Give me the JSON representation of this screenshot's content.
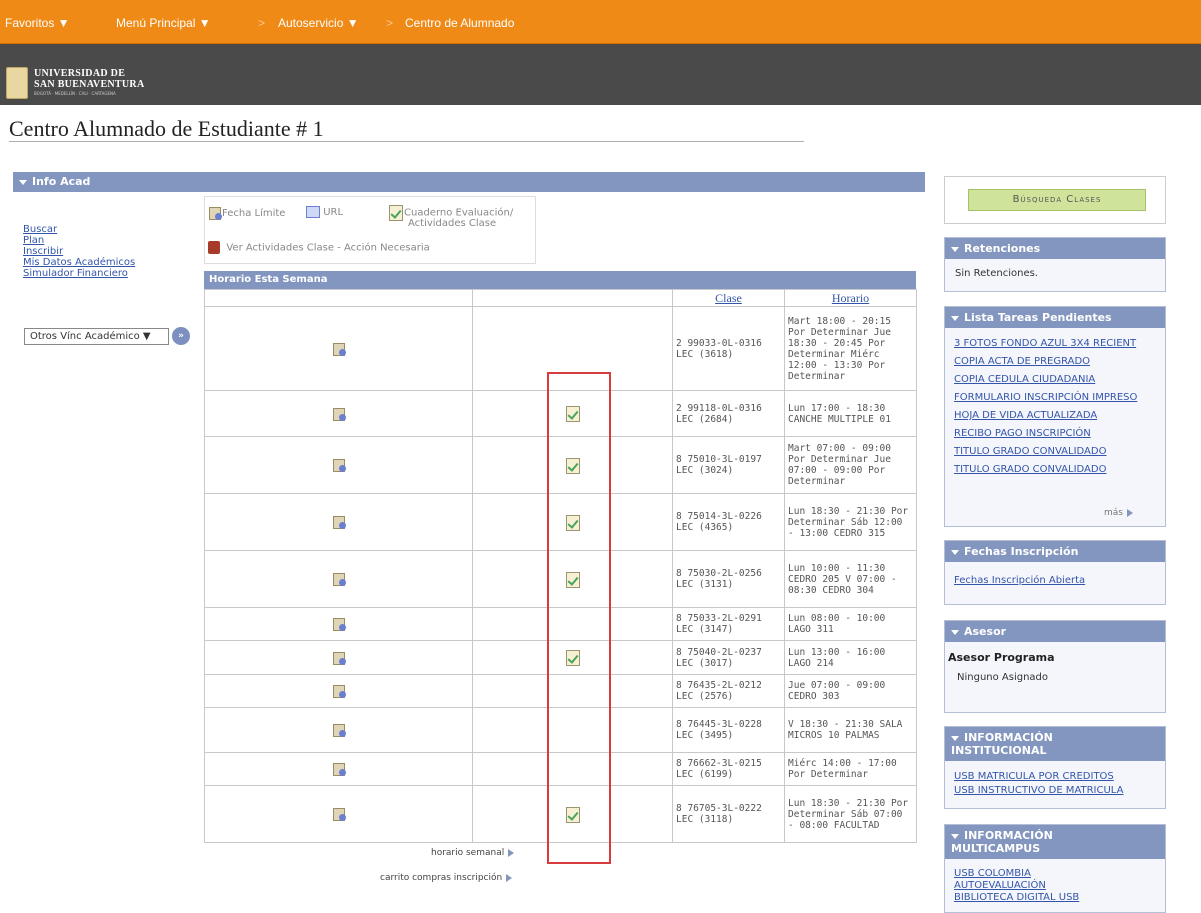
{
  "topnav": {
    "favoritos": "Favoritos ▼",
    "menu_principal": "Menú Principal ▼",
    "autoservicio": "Autoservicio ▼",
    "centro": "Centro de Alumnado",
    "separator": ">"
  },
  "logo": {
    "line1": "UNIVERSIDAD DE",
    "line2": "SAN BUENAVENTURA",
    "line3": "BOGOTÁ · MEDELLÍN · CALI · CARTAGENA"
  },
  "page_title": "Centro Alumnado de Estudiante # 1",
  "info_acad": {
    "title": "Info Acad",
    "links": [
      "Buscar",
      "Plan",
      "Inscribir",
      "Mis Datos Académicos",
      "Simulador Financiero"
    ],
    "otros_select": "Otros Vínc Académico ▼",
    "go_symbol": "»"
  },
  "legend": {
    "fecha_limite": "Fecha Límite",
    "url": "URL",
    "cuaderno_1": "Cuaderno Evaluación/",
    "cuaderno_2": "Actividades Clase",
    "ver_actividades": "Ver Actividades Clase - Acción Necesaria"
  },
  "schedule": {
    "title": "Horario Esta Semana",
    "col_clase": "Clase",
    "col_horario": "Horario",
    "rows": [
      {
        "clase": "2 99033-0L-0316 LEC (3618)",
        "horario": "Mart 18:00 - 20:15 Por Determinar Jue 18:30 - 20:45 Por Determinar Miérc 12:00 - 13:30 Por Determinar",
        "check": false
      },
      {
        "clase": "2 99118-0L-0316 LEC (2684)",
        "horario": "Lun 17:00 - 18:30 CANCHE MULTIPLE 01",
        "check": true
      },
      {
        "clase": "8 75010-3L-0197 LEC (3024)",
        "horario": "Mart 07:00 - 09:00 Por Determinar Jue 07:00 - 09:00 Por Determinar",
        "check": true
      },
      {
        "clase": "8 75014-3L-0226 LEC (4365)",
        "horario": "Lun 18:30 - 21:30 Por Determinar Sáb 12:00 - 13:00 CEDRO 315",
        "check": true
      },
      {
        "clase": "8 75030-2L-0256 LEC (3131)",
        "horario": "Lun 10:00 - 11:30 CEDRO 205 V 07:00 - 08:30 CEDRO 304",
        "check": true
      },
      {
        "clase": "8 75033-2L-0291 LEC (3147)",
        "horario": "Lun 08:00 - 10:00 LAGO 311",
        "check": false
      },
      {
        "clase": "8 75040-2L-0237 LEC (3017)",
        "horario": "Lun 13:00 - 16:00 LAGO 214",
        "check": true
      },
      {
        "clase": "8 76435-2L-0212 LEC (2576)",
        "horario": "Jue 07:00 - 09:00 CEDRO 303",
        "check": false
      },
      {
        "clase": "8 76445-3L-0228 LEC (3495)",
        "horario": "V 18:30 - 21:30 SALA MICROS 10 PALMAS",
        "check": false
      },
      {
        "clase": "8 76662-3L-0215 LEC (6199)",
        "horario": "Miérc 14:00 - 17:00 Por Determinar",
        "check": false
      },
      {
        "clase": "8 76705-3L-0222 LEC (3118)",
        "horario": "Lun 18:30 - 21:30 Por Determinar Sáb 07:00 - 08:00 FACULTAD",
        "check": true
      }
    ],
    "horario_semanal": "horario semanal",
    "carrito": "carrito compras inscripción"
  },
  "right": {
    "busqueda_btn": "Búsqueda Clases",
    "retenciones": {
      "title": "Retenciones",
      "body": "Sin Retenciones."
    },
    "tareas": {
      "title": "Lista Tareas Pendientes",
      "items": [
        "3 FOTOS FONDO AZUL 3X4 RECIENT",
        "COPIA ACTA DE PREGRADO",
        "COPIA CEDULA CIUDADANIA",
        "FORMULARIO INSCRIPCIÓN IMPRESO",
        "HOJA DE VIDA ACTUALIZADA",
        "RECIBO PAGO INSCRIPCIÓN",
        "TITULO GRADO CONVALIDADO",
        "TITULO GRADO CONVALIDADO"
      ],
      "mas": "más"
    },
    "fechas": {
      "title": "Fechas Inscripción",
      "link": "Fechas Inscripción Abierta"
    },
    "asesor": {
      "title": "Asesor",
      "subtitle": "Asesor Programa",
      "body": "Ninguno Asignado"
    },
    "info_inst": {
      "title_1": "INFORMACIÓN",
      "title_2": "INSTITUCIONAL",
      "links": [
        "USB MATRICULA POR CREDITOS",
        "USB INSTRUCTIVO DE MATRICULA"
      ]
    },
    "info_multi": {
      "title_1": "INFORMACIÓN",
      "title_2": "MULTICAMPUS",
      "links": [
        "USB COLOMBIA",
        "AUTOEVALUACIÓN",
        "BIBLIOTECA DIGITAL USB"
      ]
    }
  }
}
